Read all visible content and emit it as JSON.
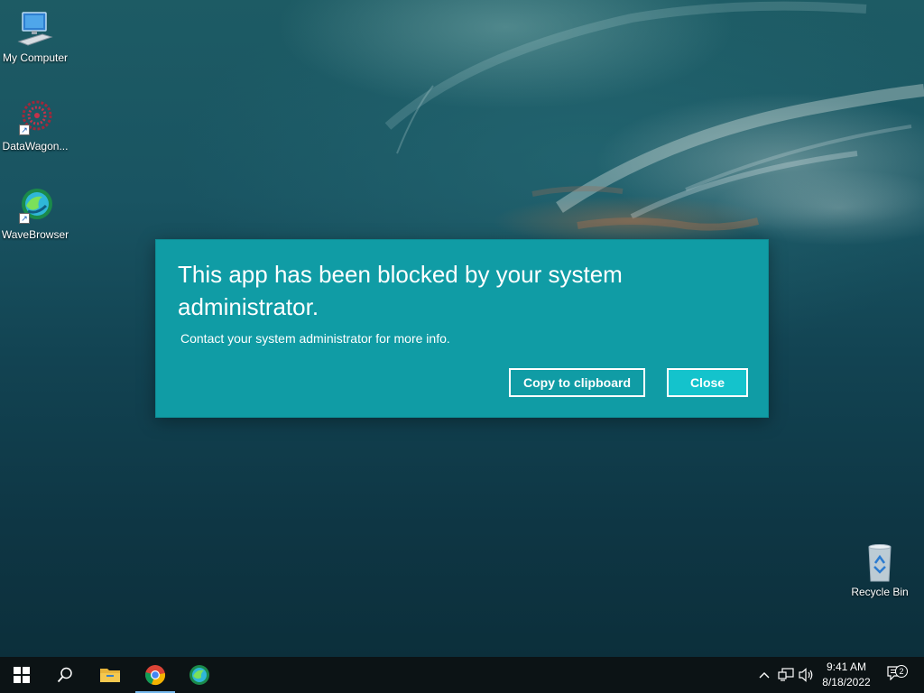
{
  "desktop": {
    "icons": [
      {
        "label": "My Computer",
        "icon": "computer-icon"
      },
      {
        "label": "DataWagon...",
        "icon": "datawagon-icon"
      },
      {
        "label": "WaveBrowser",
        "icon": "wavebrowser-icon"
      },
      {
        "label": "Recycle Bin",
        "icon": "recycle-bin-icon"
      }
    ]
  },
  "dialog": {
    "title": "This app has been blocked by your system administrator.",
    "message": "Contact your system administrator for more info.",
    "copy_label": "Copy to clipboard",
    "close_label": "Close",
    "background_color": "#109ca5",
    "close_button_color": "#14c3cc"
  },
  "taskbar": {
    "items": [
      {
        "name": "start",
        "icon": "windows-logo-icon"
      },
      {
        "name": "search",
        "icon": "search-icon"
      },
      {
        "name": "file-explorer",
        "icon": "folder-icon"
      },
      {
        "name": "chrome",
        "icon": "chrome-icon",
        "active": true
      },
      {
        "name": "wavebrowser",
        "icon": "wavebrowser-icon"
      }
    ],
    "tray": {
      "time": "9:41 AM",
      "date": "8/18/2022",
      "notification_count": "2"
    }
  }
}
